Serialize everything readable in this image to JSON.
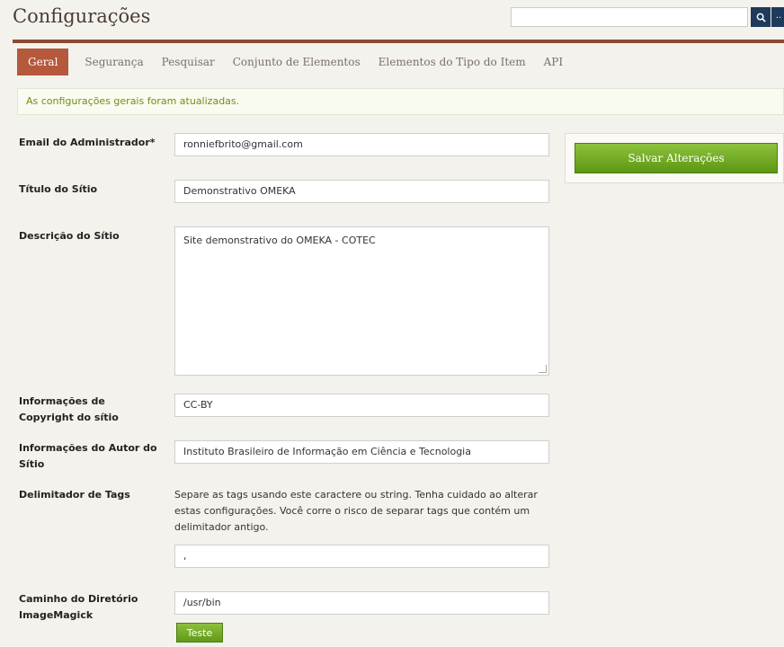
{
  "header": {
    "title": "Configurações",
    "search": {
      "value": "",
      "placeholder": ""
    },
    "advanced_label": ".."
  },
  "tabs": [
    {
      "label": "Geral",
      "active": true
    },
    {
      "label": "Segurança"
    },
    {
      "label": "Pesquisar"
    },
    {
      "label": "Conjunto de Elementos"
    },
    {
      "label": "Elementos do Tipo do Item"
    },
    {
      "label": "API"
    }
  ],
  "flash": "As configurações gerais foram atualizadas.",
  "form": {
    "admin_email": {
      "label": "Email do Administrador*",
      "value": "ronniefbrito@gmail.com"
    },
    "site_title": {
      "label": "Título do Sítio",
      "value": "Demonstrativo OMEKA"
    },
    "site_description": {
      "label": "Descrição do Sítio",
      "value": "Site demonstrativo do OMEKA - COTEC"
    },
    "copyright": {
      "label": "Informações de Copyright do sítio",
      "value": "CC-BY"
    },
    "author": {
      "label": "Informações do Autor do Sítio",
      "value": "Instituto Brasileiro de Informação em Ciência e Tecnologia"
    },
    "tag_delimiter": {
      "label": "Delimitador de Tags",
      "help": "Separe as tags usando este caractere ou string. Tenha cuidado ao alterar estas configurações. Você corre o risco de separar tags que contém um delimitador antigo.",
      "value": ","
    },
    "imagemagick": {
      "label": "Caminho do Diretório ImageMagick",
      "value": "/usr/bin",
      "test_label": "Teste"
    }
  },
  "save_label": "Salvar Alterações",
  "colors": {
    "accent": "#b5583c",
    "rule": "#8b4a34",
    "button": "#6ea523",
    "flash_text": "#6f8e16",
    "search_button": "#1e3a5c"
  },
  "icons": {
    "search": "search-icon"
  }
}
